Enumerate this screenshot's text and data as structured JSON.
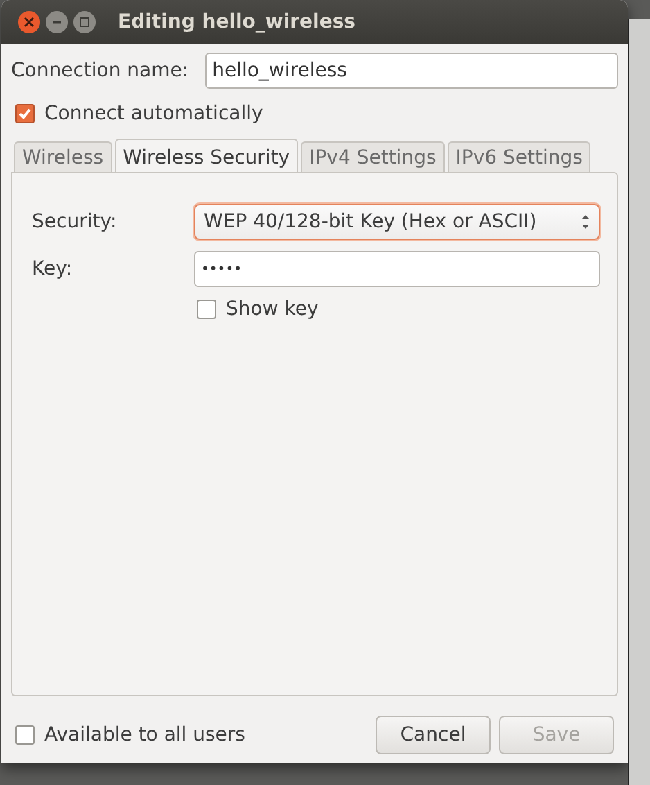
{
  "window": {
    "title": "Editing hello_wireless"
  },
  "connection_name": {
    "label": "Connection name:",
    "value": "hello_wireless"
  },
  "connect_automatically": {
    "label": "Connect automatically",
    "checked": true
  },
  "tabs": [
    {
      "label": "Wireless",
      "selected": false
    },
    {
      "label": "Wireless Security",
      "selected": true
    },
    {
      "label": "IPv4 Settings",
      "selected": false
    },
    {
      "label": "IPv6 Settings",
      "selected": false
    }
  ],
  "security": {
    "label": "Security:",
    "value": "WEP 40/128-bit Key (Hex or ASCII)"
  },
  "key": {
    "label": "Key:",
    "value": "•••••"
  },
  "show_key": {
    "label": "Show key",
    "checked": false
  },
  "available_to_all_users": {
    "label": "Available to all users",
    "checked": false
  },
  "buttons": [
    {
      "label": "Cancel",
      "disabled": false
    },
    {
      "label": "Save",
      "disabled": true
    }
  ]
}
